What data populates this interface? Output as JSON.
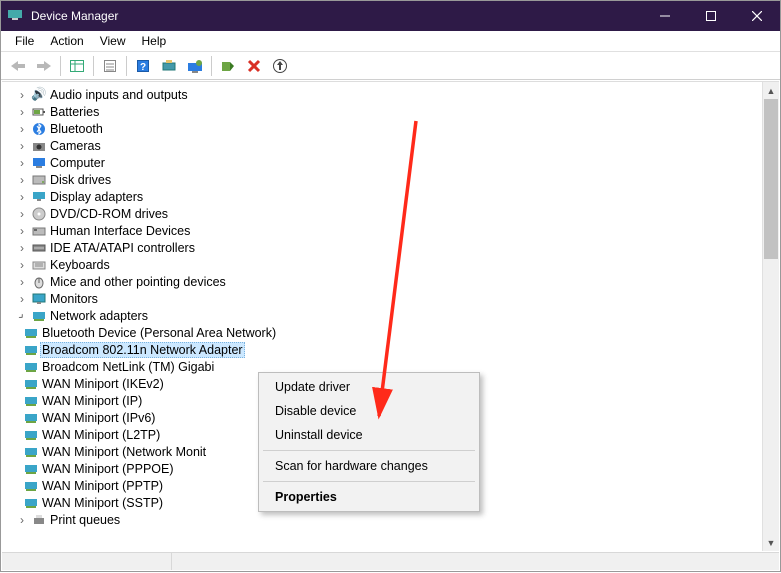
{
  "window": {
    "title": "Device Manager"
  },
  "menu": {
    "file": "File",
    "action": "Action",
    "view": "View",
    "help": "Help"
  },
  "tree": {
    "audio": "Audio inputs and outputs",
    "batteries": "Batteries",
    "bluetooth": "Bluetooth",
    "cameras": "Cameras",
    "computer": "Computer",
    "disk": "Disk drives",
    "display": "Display adapters",
    "dvd": "DVD/CD-ROM drives",
    "hid": "Human Interface Devices",
    "ide": "IDE ATA/ATAPI controllers",
    "keyboards": "Keyboards",
    "mice": "Mice and other pointing devices",
    "monitors": "Monitors",
    "netadapters": "Network adapters",
    "net": {
      "bt": "Bluetooth Device (Personal Area Network)",
      "broadcom80211": "Broadcom 802.11n Network Adapter",
      "broadcomGig": "Broadcom NetLink (TM) Gigabi",
      "wanIke": "WAN Miniport (IKEv2)",
      "wanIp": "WAN Miniport (IP)",
      "wanIpv6": "WAN Miniport (IPv6)",
      "wanL2tp": "WAN Miniport (L2TP)",
      "wanMon": "WAN Miniport (Network Monit",
      "wanPppoe": "WAN Miniport (PPPOE)",
      "wanPptp": "WAN Miniport (PPTP)",
      "wanSstp": "WAN Miniport (SSTP)"
    },
    "printqueues": "Print queues"
  },
  "ctx": {
    "update": "Update driver",
    "disable": "Disable device",
    "uninstall": "Uninstall device",
    "scan": "Scan for hardware changes",
    "properties": "Properties"
  }
}
